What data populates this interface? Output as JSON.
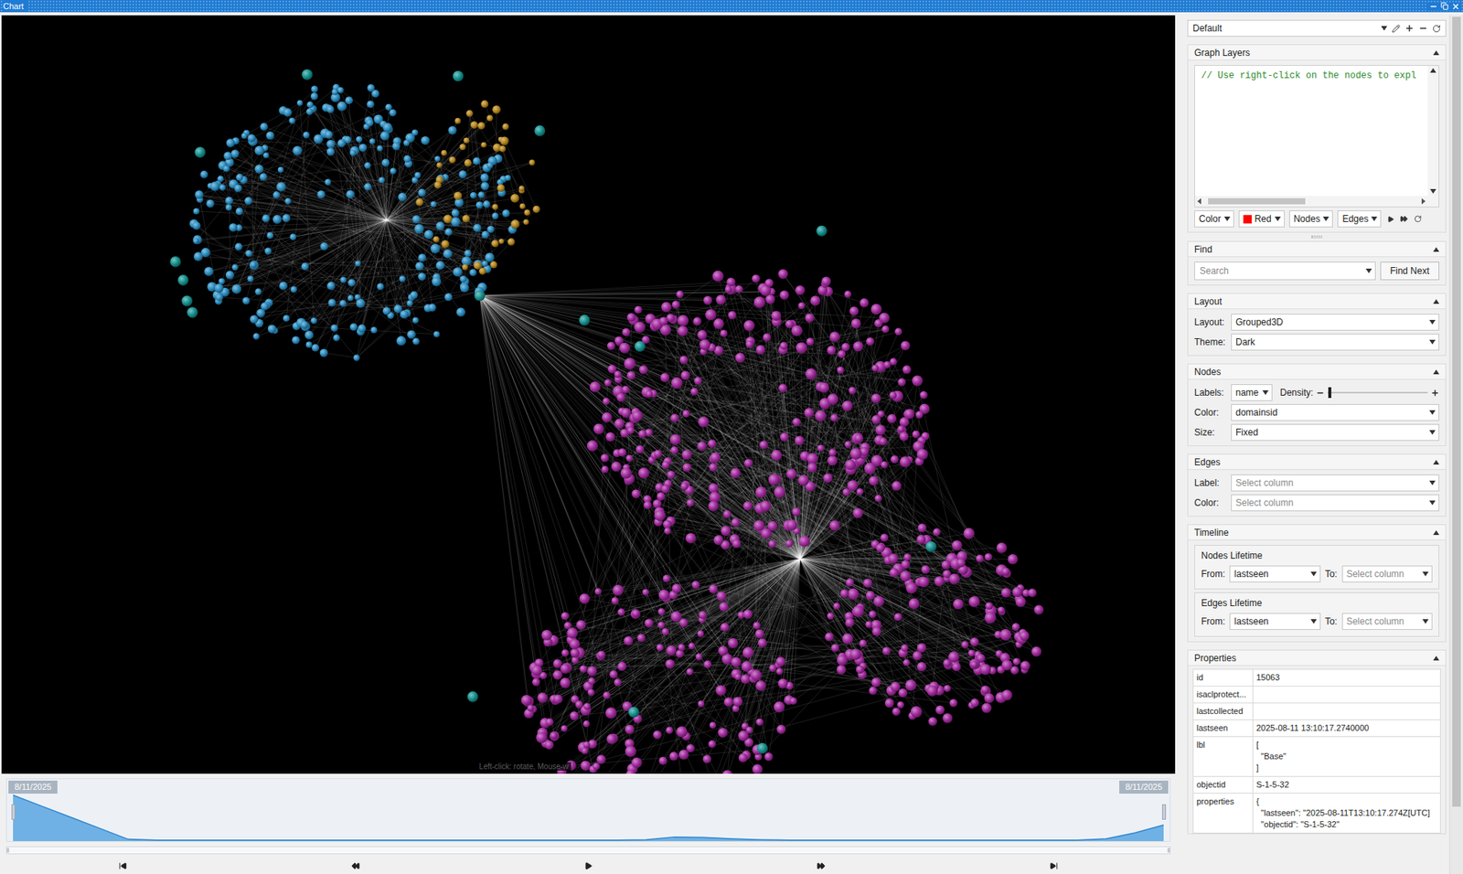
{
  "window": {
    "title": "Chart"
  },
  "graph": {
    "groups": [
      {
        "color": "#2a8cc0",
        "nodes": 260
      },
      {
        "color": "#b5861c",
        "nodes": 45
      },
      {
        "color": "#a32a9f",
        "nodes": 640
      },
      {
        "color": "#14918f",
        "nodes": 16
      }
    ],
    "hint": "Left-click: rotate, Mouse-w"
  },
  "timeline": {
    "start": "8/11/2025",
    "end": "8/11/2025",
    "values": [
      100,
      76,
      52,
      28,
      4,
      2,
      2,
      2,
      2,
      2,
      2,
      2,
      2,
      2,
      2,
      2,
      2,
      2,
      2,
      2,
      2,
      2,
      3,
      9,
      8,
      5,
      3,
      2,
      2,
      2,
      2,
      2,
      2,
      2,
      2,
      2,
      2,
      2,
      5,
      18,
      35
    ],
    "selection": {
      "start": 0,
      "end": 1
    }
  },
  "panel": {
    "profile": {
      "value": "Default"
    },
    "scrollbar": {
      "offset": 0,
      "size": 0.92
    },
    "graph_layers": {
      "title": "Graph Layers",
      "expanded": true,
      "code": "// Use right-click on the nodes to expl",
      "hscroll": {
        "offset": 0.02,
        "size": 0.45
      },
      "controls": [
        {
          "kind": "dropdown",
          "value": "Color"
        },
        {
          "kind": "color",
          "value": "Red",
          "color": "#ff0000"
        },
        {
          "kind": "dropdown",
          "value": "Nodes"
        },
        {
          "kind": "dropdown",
          "value": "Edges"
        }
      ]
    },
    "find": {
      "title": "Find",
      "expanded": true,
      "placeholder": "Search",
      "button": "Find Next"
    },
    "layout": {
      "title": "Layout",
      "expanded": true,
      "fields": [
        {
          "label": "Layout:",
          "value": "Grouped3D",
          "placeholder": ""
        },
        {
          "label": "Theme:",
          "value": "Dark",
          "placeholder": ""
        }
      ]
    },
    "nodes": {
      "title": "Nodes",
      "expanded": true,
      "labels": {
        "label": "Labels:",
        "value": "name"
      },
      "density": {
        "label": "Density:",
        "level": 0.02
      },
      "fields": [
        {
          "label": "Color:",
          "value": "domainsid",
          "placeholder": ""
        },
        {
          "label": "Size:",
          "value": "Fixed",
          "placeholder": ""
        }
      ]
    },
    "edges": {
      "title": "Edges",
      "expanded": true,
      "fields": [
        {
          "label": "Label:",
          "value": "",
          "placeholder": "Select column"
        },
        {
          "label": "Color:",
          "value": "",
          "placeholder": "Select column"
        }
      ]
    },
    "timeline": {
      "title": "Timeline",
      "expanded": true,
      "groups": [
        {
          "title": "Nodes Lifetime",
          "from_label": "From:",
          "from": "lastseen",
          "to_label": "To:",
          "to": "",
          "to_placeholder": "Select column"
        },
        {
          "title": "Edges Lifetime",
          "from_label": "From:",
          "from": "lastseen",
          "to_label": "To:",
          "to": "",
          "to_placeholder": "Select column"
        }
      ]
    },
    "properties": {
      "title": "Properties",
      "expanded": true,
      "rows": [
        {
          "name": "id",
          "value": "15063"
        },
        {
          "name": "isaclprotect...",
          "value": ""
        },
        {
          "name": "lastcollected",
          "value": ""
        },
        {
          "name": "lastseen",
          "value": "2025-08-11 13:10:17.2740000"
        },
        {
          "name": "lbl",
          "value": "[\n  \"Base\"\n]"
        },
        {
          "name": "objectid",
          "value": "S-1-5-32"
        },
        {
          "name": "properties",
          "value": "{\n  \"lastseen\": \"2025-08-11T13:10:17.274Z[UTC]\n  \"objectid\": \"S-1-5-32\""
        }
      ]
    }
  }
}
